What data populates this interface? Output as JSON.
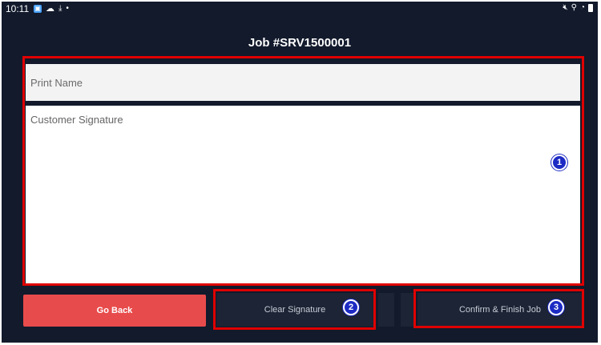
{
  "status_bar": {
    "time": "10:11",
    "left_icons": [
      "app-notification-icon",
      "cloud-icon",
      "download-icon",
      "dot-icon"
    ],
    "right_icons": [
      "mute-icon",
      "location-icon",
      "wifi-icon",
      "battery-icon"
    ]
  },
  "header": {
    "title": "Job #SRV1500001"
  },
  "form": {
    "print_name_placeholder": "Print Name",
    "signature_label": "Customer Signature"
  },
  "buttons": {
    "go_back": "Go Back",
    "clear_signature": "Clear Signature",
    "confirm_finish": "Confirm & Finish Job"
  },
  "annotations": {
    "badge_1": "1",
    "badge_2": "2",
    "badge_3": "3"
  },
  "colors": {
    "background": "#121a2c",
    "go_back": "#e84b4b",
    "highlight": "#e00000",
    "badge": "#1d2bc4"
  }
}
